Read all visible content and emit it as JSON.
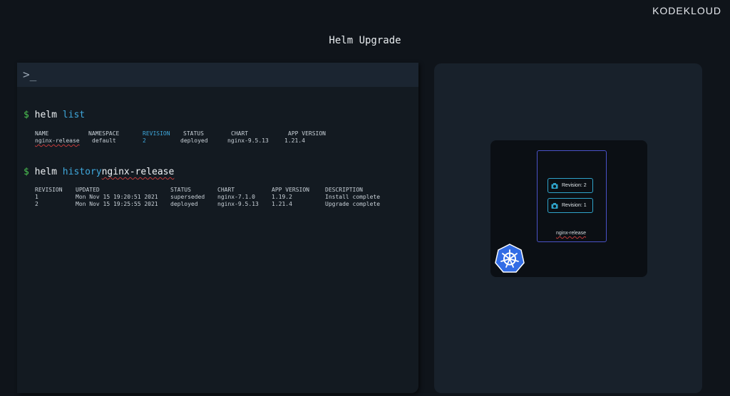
{
  "brand": "KODEKLOUD",
  "title": "Helm Upgrade",
  "terminal": {
    "prompt_symbol": ">_",
    "cmd1": {
      "dollar": "$",
      "base": "helm",
      "arg": "list"
    },
    "list_table": {
      "headers": [
        "NAME",
        "NAMESPACE",
        "REVISION",
        "STATUS",
        "CHART",
        "APP VERSION"
      ],
      "rows": [
        [
          "nginx-release",
          "default",
          "2",
          "deployed",
          "nginx-9.5.13",
          "1.21.4"
        ]
      ]
    },
    "cmd2": {
      "dollar": "$",
      "base": "helm",
      "arg": "history",
      "target": "nginx-release"
    },
    "history_table": {
      "headers": [
        "REVISION",
        "UPDATED",
        "STATUS",
        "CHART",
        "APP VERSION",
        "DESCRIPTION"
      ],
      "rows": [
        [
          "1",
          "Mon Nov 15 19:20:51 2021",
          "superseded",
          "nginx-7.1.0",
          "1.19.2",
          "Install complete"
        ],
        [
          "2",
          "Mon Nov 15 19:25:55 2021",
          "deployed",
          "nginx-9.5.13",
          "1.21.4",
          "Upgrade complete"
        ]
      ]
    }
  },
  "diagram": {
    "revisions": [
      "Revision: 2",
      "Revision: 1"
    ],
    "release_name": "nginx-release"
  },
  "colors": {
    "accent": "#3fa8dc",
    "prompt_green": "#4cc552",
    "release_border": "#4a52c8",
    "k8s_blue": "#326ce5"
  },
  "icons": {
    "terminal": "terminal-prompt-icon",
    "revision": "camera-icon",
    "cluster": "kubernetes-helm-icon"
  }
}
